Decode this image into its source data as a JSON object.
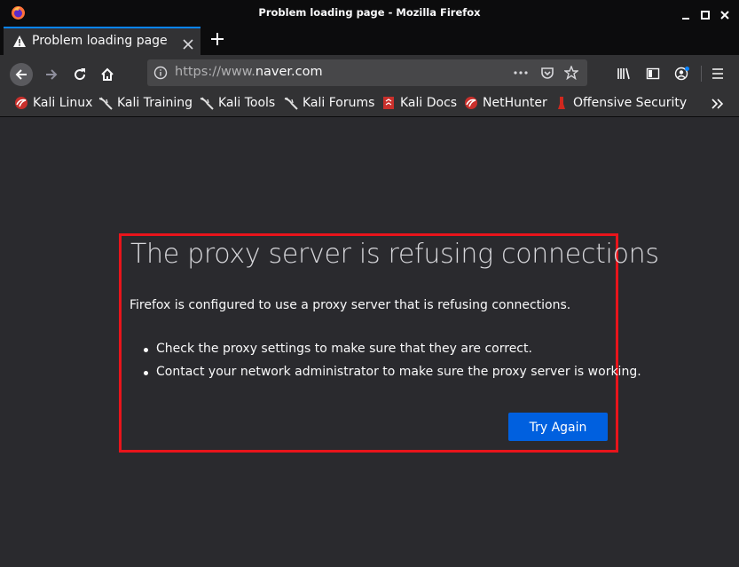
{
  "window": {
    "title": "Problem loading page - Mozilla Firefox"
  },
  "tabs": [
    {
      "label": "Problem loading page",
      "active": true
    }
  ],
  "urlbar": {
    "scheme": "https://www.",
    "host": "naver.com"
  },
  "bookmarks": [
    {
      "label": "Kali Linux",
      "icon": "kali-dragon-icon"
    },
    {
      "label": "Kali Training",
      "icon": "kali-dragon-icon"
    },
    {
      "label": "Kali Tools",
      "icon": "kali-dragon-icon"
    },
    {
      "label": "Kali Forums",
      "icon": "kali-dragon-icon"
    },
    {
      "label": "Kali Docs",
      "icon": "kali-docs-icon"
    },
    {
      "label": "NetHunter",
      "icon": "kali-dragon-icon"
    },
    {
      "label": "Offensive Security",
      "icon": "offsec-icon"
    }
  ],
  "error": {
    "title": "The proxy server is refusing connections",
    "description": "Firefox is configured to use a proxy server that is refusing connections.",
    "items": [
      "Check the proxy settings to make sure that they are correct.",
      "Contact your network administrator to make sure the proxy server is working."
    ],
    "button_label": "Try Again"
  },
  "colors": {
    "accent": "#0a84ff",
    "button": "#0060df",
    "highlight_box": "#e8141b"
  }
}
